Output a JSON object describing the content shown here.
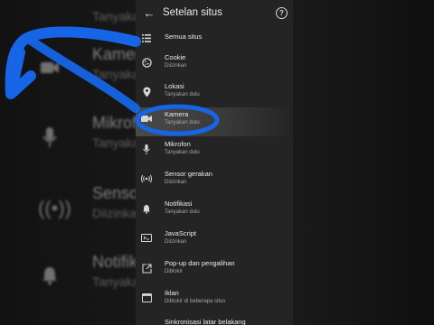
{
  "background": {
    "rows": [
      {
        "title": "",
        "subtitle": "Tanyakan dulu",
        "icon": "settings-icon"
      },
      {
        "title": "Kamera",
        "subtitle": "Tanyakan dulu",
        "icon": "camera-icon"
      },
      {
        "title": "Mikrofon",
        "subtitle": "Tanyakan dulu",
        "icon": "microphone-icon"
      },
      {
        "title": "Sensor gerakan",
        "subtitle": "Diizinkan",
        "icon": "motion-sensor-icon"
      },
      {
        "title": "Notifikasi",
        "subtitle": "Tanyakan dulu",
        "icon": "bell-icon"
      }
    ]
  },
  "app_bar": {
    "title": "Setelan situs",
    "back_icon": "arrow-back-icon",
    "help_icon": "help-icon"
  },
  "list": [
    {
      "title": "Semua situs",
      "subtitle": "",
      "icon": "list-icon"
    },
    {
      "title": "Cookie",
      "subtitle": "Diizinkan",
      "icon": "cookie-icon"
    },
    {
      "title": "Lokasi",
      "subtitle": "Tanyakan dulu",
      "icon": "location-icon"
    },
    {
      "title": "Kamera",
      "subtitle": "Tanyakan dulu",
      "icon": "camera-icon"
    },
    {
      "title": "Mikrofon",
      "subtitle": "Tanyakan dulu",
      "icon": "microphone-icon"
    },
    {
      "title": "Sensor gerakan",
      "subtitle": "Diizinkan",
      "icon": "motion-sensor-icon"
    },
    {
      "title": "Notifikasi",
      "subtitle": "Tanyakan dulu",
      "icon": "bell-icon"
    },
    {
      "title": "JavaScript",
      "subtitle": "Diizinkan",
      "icon": "javascript-icon"
    },
    {
      "title": "Pop-up dan pengalihan",
      "subtitle": "Diblokir",
      "icon": "popup-icon"
    },
    {
      "title": "Iklan",
      "subtitle": "Diblokir di beberapa situs",
      "icon": "ads-icon"
    },
    {
      "title": "Sinkronisasi latar belakang",
      "subtitle": "",
      "icon": "sync-icon"
    }
  ],
  "colors": {
    "panel": "#242424",
    "highlight": "#4a4a4a",
    "annotation": "#1565e6"
  }
}
